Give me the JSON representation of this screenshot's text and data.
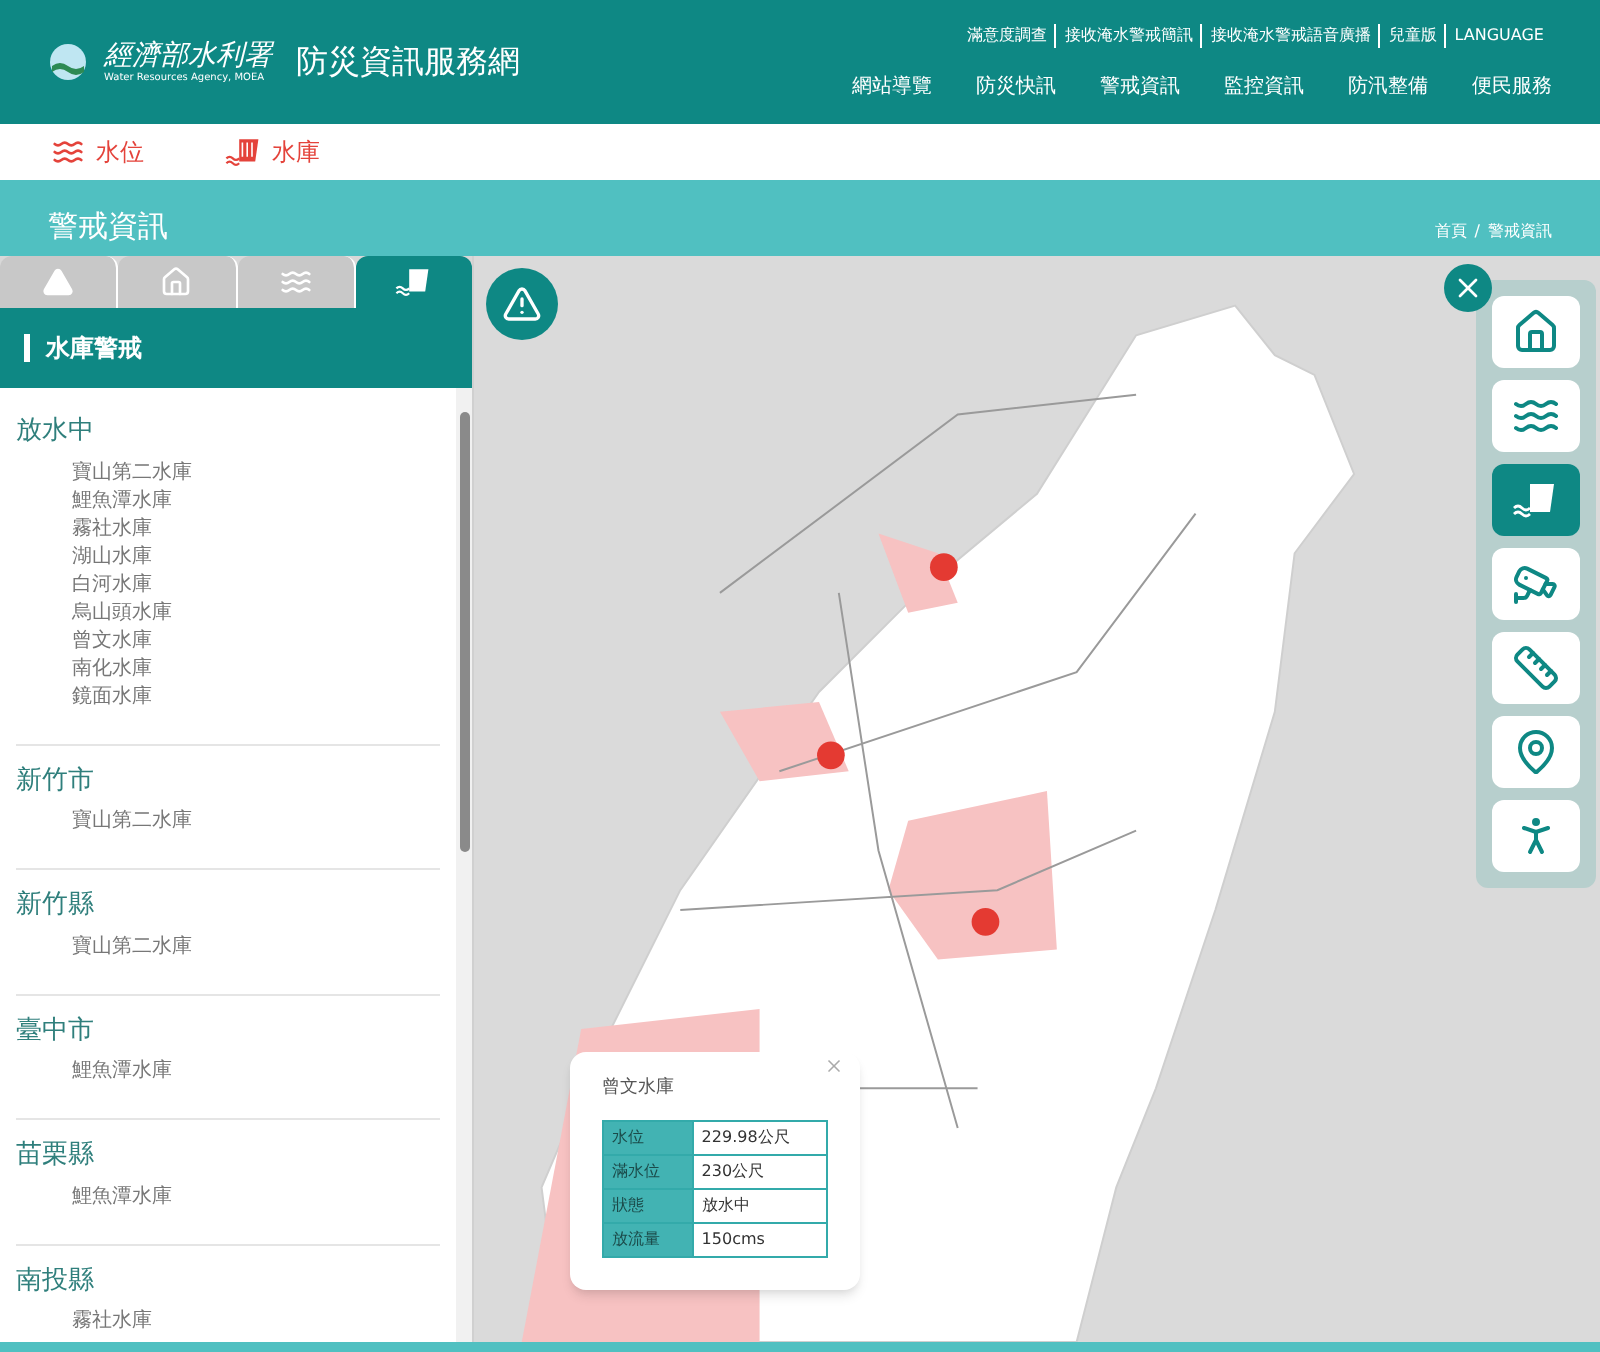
{
  "header": {
    "agency_logo_text": "經濟部水利署",
    "agency_english": "Water Resources Agency, MOEA",
    "site_title": "防災資訊服務網",
    "top_links": [
      "滿意度調查",
      "接收淹水警戒簡訊",
      "接收淹水警戒語音廣播",
      "兒童版",
      "LANGUAGE"
    ],
    "nav": [
      "網站導覽",
      "防災快訊",
      "警戒資訊",
      "監控資訊",
      "防汛整備",
      "便民服務"
    ]
  },
  "sub_tabs": [
    {
      "label": "水位",
      "kind": "water_level"
    },
    {
      "label": "水庫",
      "kind": "reservoir"
    }
  ],
  "banner": {
    "title": "警戒資訊",
    "breadcrumb": [
      "首頁",
      "警戒資訊"
    ],
    "breadcrumb_separator": "/"
  },
  "sidebar": {
    "tabs": [
      {
        "kind": "warning",
        "selected": false
      },
      {
        "kind": "flood_house",
        "selected": false
      },
      {
        "kind": "waves",
        "selected": false
      },
      {
        "kind": "reservoir",
        "selected": true
      }
    ],
    "section_title": "水庫警戒",
    "groups": [
      {
        "title": "放水中",
        "items": [
          "寶山第二水庫",
          "鯉魚潭水庫",
          "霧社水庫",
          "湖山水庫",
          "白河水庫",
          "烏山頭水庫",
          "曾文水庫",
          "南化水庫",
          "鏡面水庫"
        ]
      },
      {
        "title": "新竹市",
        "items": [
          "寶山第二水庫"
        ]
      },
      {
        "title": "新竹縣",
        "items": [
          "寶山第二水庫"
        ]
      },
      {
        "title": "臺中市",
        "items": [
          "鯉魚潭水庫"
        ]
      },
      {
        "title": "苗栗縣",
        "items": [
          "鯉魚潭水庫"
        ]
      },
      {
        "title": "南投縣",
        "items": [
          "霧社水庫"
        ]
      }
    ]
  },
  "map": {
    "popup": {
      "title": "曾文水庫",
      "rows": [
        {
          "label": "水位",
          "value": "229.98公尺"
        },
        {
          "label": "滿水位",
          "value": "230公尺"
        },
        {
          "label": "狀態",
          "value": "放水中"
        },
        {
          "label": "放流量",
          "value": "150cms"
        }
      ]
    },
    "toolbar": [
      {
        "kind": "flood_house",
        "selected": false
      },
      {
        "kind": "waves",
        "selected": false
      },
      {
        "kind": "reservoir",
        "selected": true
      },
      {
        "kind": "camera",
        "selected": false
      },
      {
        "kind": "gauge",
        "selected": false
      },
      {
        "kind": "pin",
        "selected": false
      },
      {
        "kind": "evacuate",
        "selected": false
      }
    ]
  }
}
